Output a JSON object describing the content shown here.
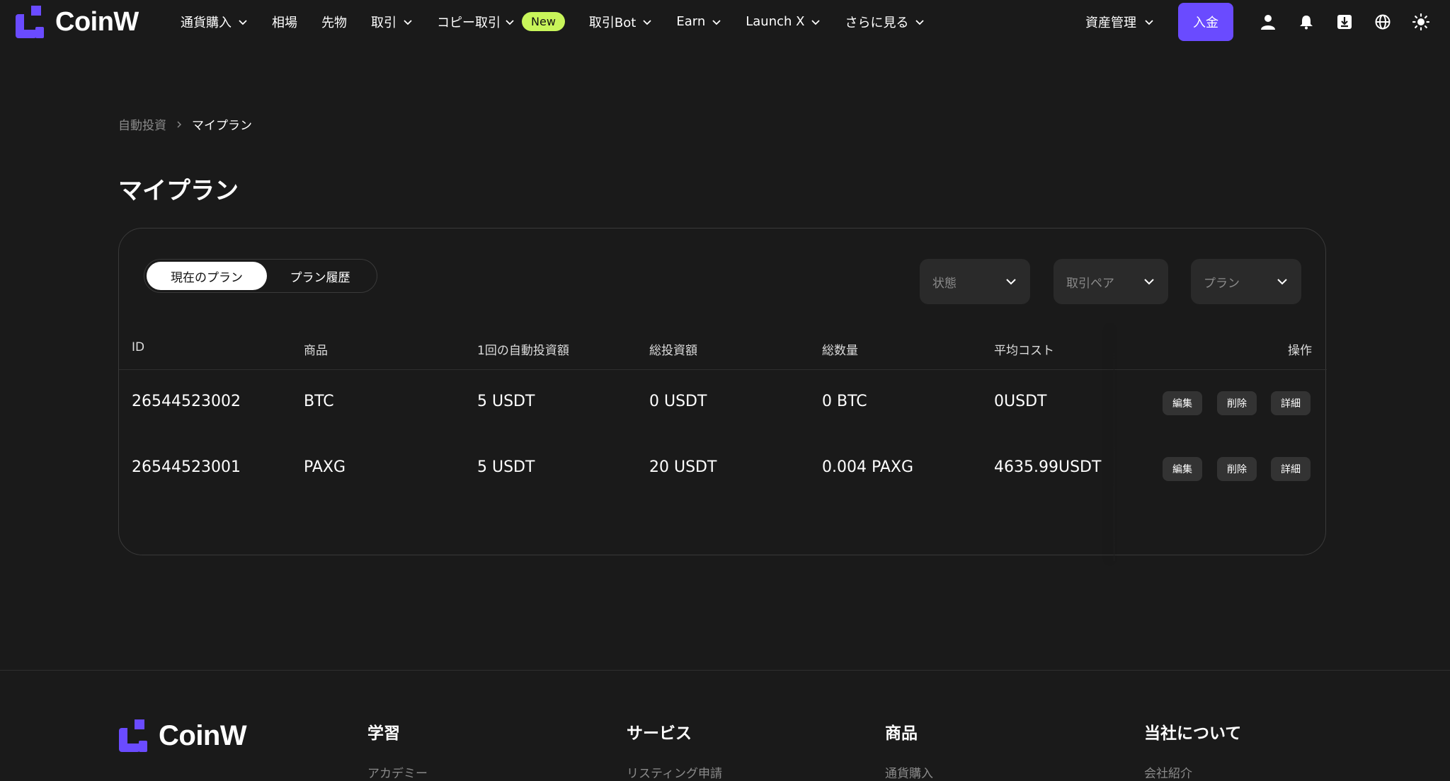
{
  "brand": {
    "name": "CoinW",
    "accent": "#6a4bff"
  },
  "nav": {
    "items": [
      {
        "label": "通貨購入",
        "dropdown": true
      },
      {
        "label": "相場",
        "dropdown": false
      },
      {
        "label": "先物",
        "dropdown": false
      },
      {
        "label": "取引",
        "dropdown": true
      },
      {
        "label": "コピー取引",
        "dropdown": true,
        "badge": "New"
      },
      {
        "label": "取引Bot",
        "dropdown": true
      },
      {
        "label": "Earn",
        "dropdown": true
      },
      {
        "label": "Launch X",
        "dropdown": true
      },
      {
        "label": "さらに見る",
        "dropdown": true
      }
    ],
    "asset_menu": "資産管理",
    "deposit": "入金",
    "icons": [
      "user-icon",
      "bell-icon",
      "download-icon",
      "globe-icon",
      "sun-icon"
    ]
  },
  "breadcrumb": {
    "parent": "自動投資",
    "current": "マイプラン"
  },
  "page_title": "マイプラン",
  "tabs": {
    "active": "現在のプラン",
    "inactive": "プラン履歴"
  },
  "filters": {
    "status": "状態",
    "pair": "取引ペア",
    "plan": "プラン"
  },
  "table": {
    "headers": [
      "ID",
      "商品",
      "1回の自動投資額",
      "総投資額",
      "総数量",
      "平均コスト",
      "操作"
    ],
    "rows": [
      {
        "id": "26544523002",
        "product": "BTC",
        "per": "5 USDT",
        "total": "0 USDT",
        "qty": "0 BTC",
        "avg": "0USDT"
      },
      {
        "id": "26544523001",
        "product": "PAXG",
        "per": "5 USDT",
        "total": "20 USDT",
        "qty": "0.004 PAXG",
        "avg": "4635.99USDT"
      }
    ],
    "actions": {
      "edit": "編集",
      "delete": "削除",
      "detail": "詳細"
    }
  },
  "footer": {
    "brand": "CoinW",
    "columns": [
      {
        "title": "学習",
        "first": "アカデミー"
      },
      {
        "title": "サービス",
        "first": "リスティング申請"
      },
      {
        "title": "商品",
        "first": "通貨購入"
      },
      {
        "title": "当社について",
        "first": "会社紹介"
      }
    ]
  }
}
